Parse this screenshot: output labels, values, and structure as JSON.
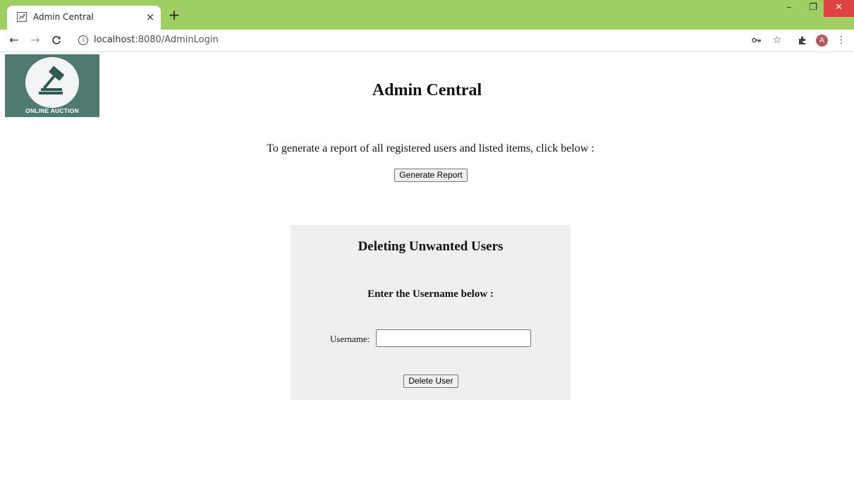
{
  "browser": {
    "tab_title": "Admin Central",
    "tab_close": "×",
    "new_tab": "+",
    "url_host": "localhost",
    "url_path": ":8080/AdminLogin",
    "avatar_initial": "A",
    "window_controls": {
      "minimize": "–",
      "maximize": "❐",
      "close": "✕"
    },
    "nav": {
      "back": "←",
      "forward": "→",
      "reload": "C"
    },
    "colors": {
      "titlebar": "#9fcf63",
      "close": "#e04343",
      "avatar": "#b35a5a"
    }
  },
  "logo": {
    "text": "ONLINE AUCTION",
    "background": "#4f7a70"
  },
  "page": {
    "title": "Admin Central",
    "report_text": "To generate a report of all registered users and listed items, click below :",
    "generate_button": "Generate Report"
  },
  "delete_panel": {
    "title": "Deleting Unwanted Users",
    "subtitle": "Enter the Username below :",
    "username_label": "Username:",
    "username_value": "",
    "delete_button": "Delete User",
    "background": "#efefef"
  }
}
